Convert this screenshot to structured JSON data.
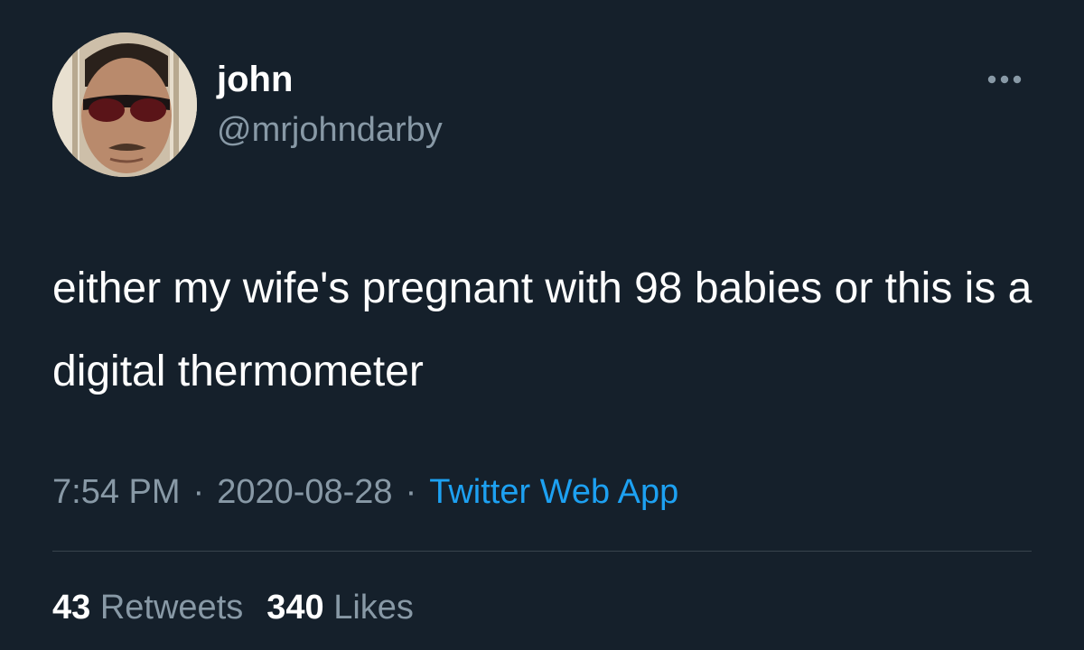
{
  "author": {
    "display_name": "john",
    "handle": "@mrjohndarby"
  },
  "tweet": {
    "text": "either my wife's pregnant with 98 babies or this is a digital thermometer",
    "time": "7:54 PM",
    "separator": "·",
    "date": "2020-08-28",
    "source": "Twitter Web App"
  },
  "stats": {
    "retweets_count": "43",
    "retweets_label": "Retweets",
    "likes_count": "340",
    "likes_label": "Likes"
  },
  "icons": {
    "more": "more-dots-icon",
    "avatar": "avatar-photo"
  },
  "colors": {
    "background": "#15202b",
    "primary_text": "#ffffff",
    "secondary_text": "#8899a6",
    "link": "#1da1f2",
    "divider": "#38444d"
  }
}
